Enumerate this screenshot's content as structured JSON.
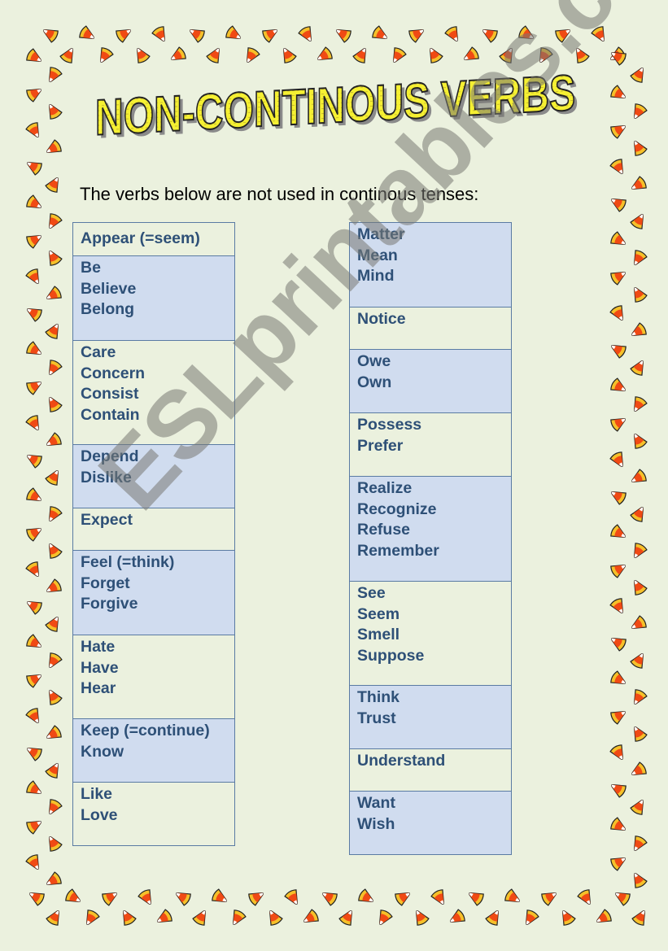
{
  "title": "NON-CONTINOUS VERBS",
  "subtitle": "The verbs below are not used in continous tenses:",
  "watermark": "ESLprintables.com",
  "colors": {
    "background": "#ebf1de",
    "cell_shade": "#d0dcef",
    "text": "#2e5077",
    "border": "#5a7ba3",
    "title_fill": "#f5f032",
    "candy_orange": "#f04a14",
    "candy_yellow": "#f5c02a"
  },
  "border_icon": "candy-corn-icon",
  "left_column": [
    {
      "shade": false,
      "words": [
        "Appear (=seem)"
      ]
    },
    {
      "shade": true,
      "words": [
        "Be",
        "Believe",
        "Belong"
      ]
    },
    {
      "shade": false,
      "words": [
        "Care",
        "Concern",
        "Consist",
        "Contain"
      ]
    },
    {
      "shade": true,
      "words": [
        "Depend",
        "Dislike"
      ]
    },
    {
      "shade": false,
      "words": [
        "Expect"
      ]
    },
    {
      "shade": true,
      "words": [
        "Feel (=think)",
        "Forget",
        "Forgive"
      ]
    },
    {
      "shade": false,
      "words": [
        "Hate",
        "Have",
        "Hear"
      ]
    },
    {
      "shade": true,
      "words": [
        "Keep (=continue)",
        "Know"
      ]
    },
    {
      "shade": false,
      "words": [
        "Like",
        "Love"
      ]
    }
  ],
  "right_column": [
    {
      "shade": true,
      "words": [
        "Matter",
        "Mean",
        "Mind"
      ]
    },
    {
      "shade": false,
      "words": [
        "Notice"
      ]
    },
    {
      "shade": true,
      "words": [
        "Owe",
        "Own"
      ]
    },
    {
      "shade": false,
      "words": [
        "Possess",
        "Prefer"
      ]
    },
    {
      "shade": true,
      "words": [
        "Realize",
        "Recognize",
        "Refuse",
        "Remember"
      ]
    },
    {
      "shade": false,
      "words": [
        "See",
        "Seem",
        "Smell",
        "Suppose"
      ]
    },
    {
      "shade": true,
      "words": [
        "Think",
        "Trust"
      ]
    },
    {
      "shade": false,
      "words": [
        "Understand"
      ]
    },
    {
      "shade": true,
      "words": [
        "Want",
        "Wish"
      ]
    }
  ]
}
